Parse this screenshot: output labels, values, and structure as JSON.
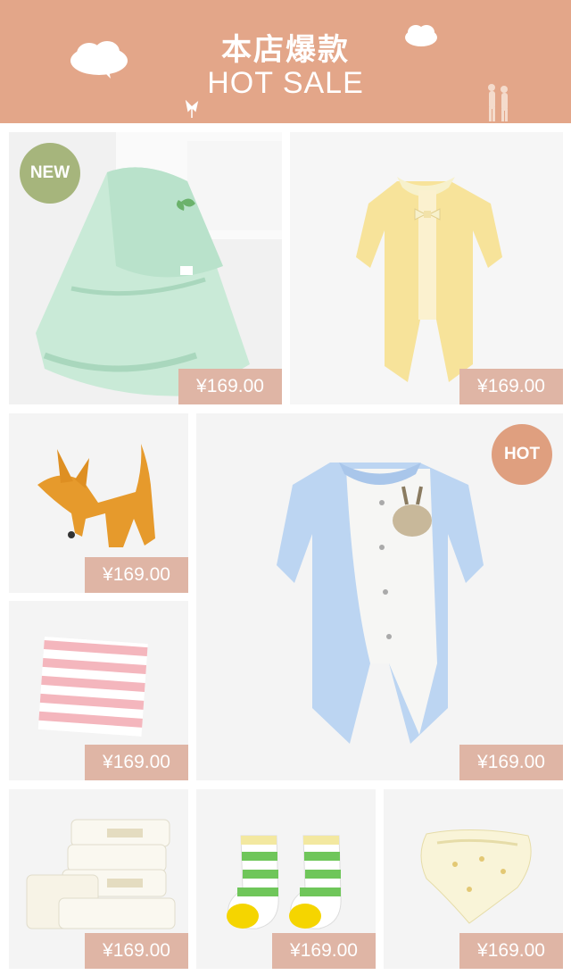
{
  "header": {
    "title_cn": "本店爆款",
    "title_en": "HOT SALE"
  },
  "colors": {
    "header_bg": "#e3a689",
    "price_tag": "#dfb5a5",
    "new_badge": "#a6b57c",
    "hot_badge": "#df9f7f"
  },
  "products": [
    {
      "name": "swaddle-blanket",
      "price": "¥169.00",
      "badge": "NEW"
    },
    {
      "name": "yellow-romper",
      "price": "¥169.00"
    },
    {
      "name": "fox-plush-toy",
      "price": "¥169.00"
    },
    {
      "name": "blue-romper",
      "price": "¥169.00",
      "badge": "HOT"
    },
    {
      "name": "striped-towel",
      "price": "¥169.00"
    },
    {
      "name": "baby-wipes",
      "price": "¥169.00"
    },
    {
      "name": "striped-socks",
      "price": "¥169.00"
    },
    {
      "name": "cloth-diaper",
      "price": "¥169.00"
    }
  ]
}
